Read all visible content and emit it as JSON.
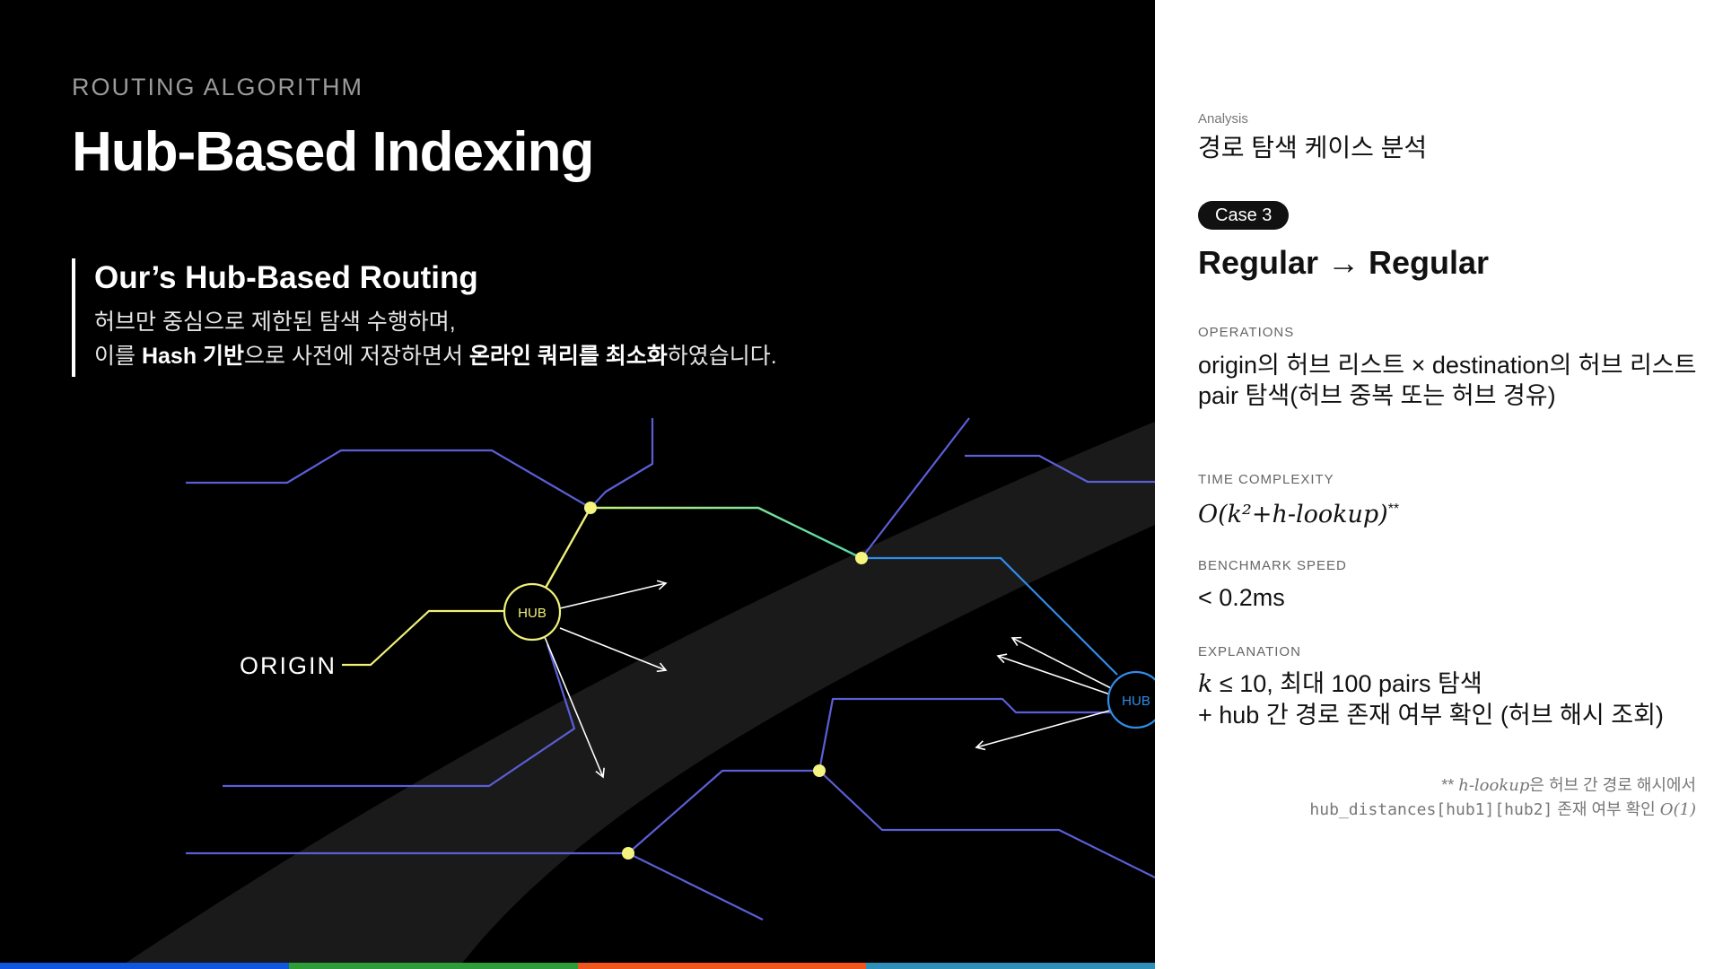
{
  "header": {
    "eyebrow": "ROUTING ALGORITHM",
    "title": "Hub-Based Indexing"
  },
  "quote": {
    "title": "Our’s Hub-Based Routing",
    "line1": "허브만 중심으로 제한된 탐색 수행하며,",
    "line2_a": "이를 ",
    "line2_b": "Hash 기반",
    "line2_c": "으로 사전에 저장하면서 ",
    "line2_d": "온라인 쿼리를 최소화",
    "line2_e": "하였습니다."
  },
  "diagram": {
    "origin_label": "ORIGIN",
    "hub_label": "HUB",
    "hub2_label": "HUB",
    "colors": {
      "origin_path": "#f0f07a",
      "hub_yellow": "#f0f07a",
      "dot": "#f4f47e",
      "green": "#6fe08c",
      "cyan": "#35a8e6",
      "blue": "#2f8de8",
      "purple": "#5b5fd6",
      "band": "#1a1a1a"
    }
  },
  "bottom_bar": [
    "#1156e0",
    "#2f9c3a",
    "#f0561c",
    "#2e8fb8"
  ],
  "panel": {
    "analysis_label": "Analysis",
    "analysis_title": "경로 탐색 케이스 분석",
    "case_badge": "Case 3",
    "case_title": "Regular → Regular",
    "operations_label": "OPERATIONS",
    "operations_line1": "origin의 허브 리스트 × destination의 허브 리스트",
    "operations_line2": "pair 탐색(허브 중복 또는 허브 경유)",
    "time_label": "TIME COMPLEXITY",
    "time_value": "O(k²+h-lookup)",
    "time_mark": "**",
    "speed_label": "BENCHMARK SPEED",
    "speed_value": "< 0.2ms",
    "explanation_label": "EXPLANATION",
    "explanation_k": "k",
    "explanation_line1": " ≤ 10, 최대 100 pairs 탐색",
    "explanation_line2": "+ hub 간 경로 존재 여부 확인 (허브 해시 조회)",
    "footnote_mark": "** ",
    "footnote_term": "h-lookup",
    "footnote_line1": "은 허브 간 경로 해시에서",
    "footnote_code": "hub_distances[hub1][hub2]",
    "footnote_line2": " 존재 여부 확인 ",
    "footnote_o": "O(1)"
  }
}
